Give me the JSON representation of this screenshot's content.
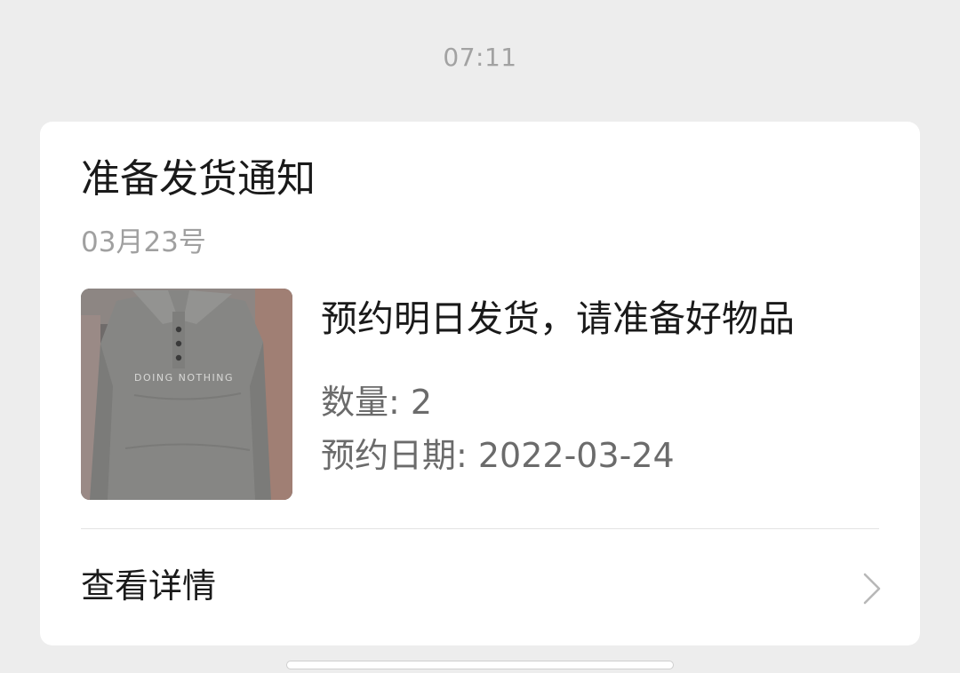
{
  "timestamp": "07:11",
  "card": {
    "title": "准备发货通知",
    "date": "03月23号",
    "product_image": {
      "icon": "product-thumbnail",
      "print_text": "DOING NOTHING"
    },
    "headline": "预约明日发货，请准备好物品",
    "quantity": "数量: 2",
    "reserve_date": "预约日期: 2022-03-24",
    "details_label": "查看详情"
  }
}
